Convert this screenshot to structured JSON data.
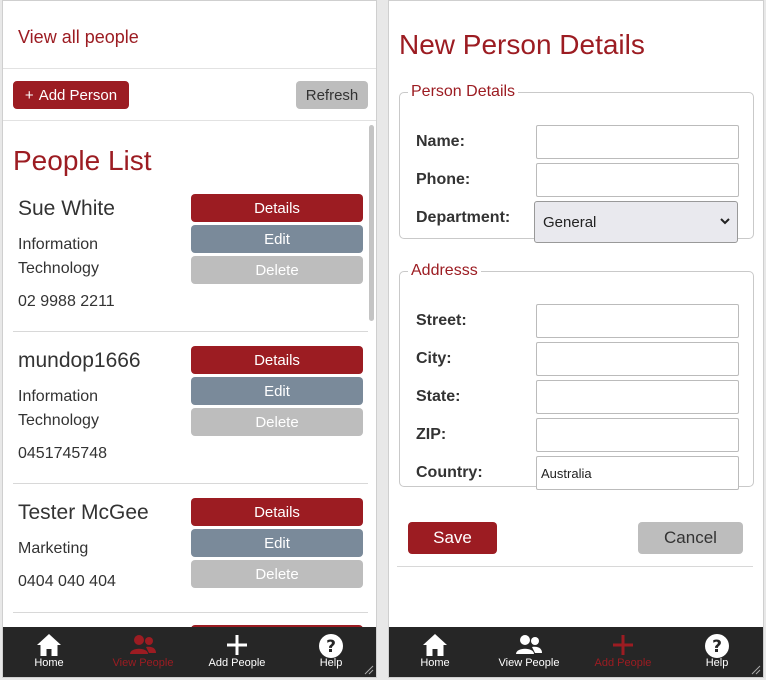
{
  "left": {
    "view_all_link": "View all people",
    "add_button": "Add Person",
    "add_button_icon": "+",
    "refresh_button": "Refresh",
    "list_title": "People List",
    "people": [
      {
        "name": "Sue White",
        "department": "Information Technology",
        "phone": "02 9988 2211"
      },
      {
        "name": "mundop1666",
        "department": "Information Technology",
        "phone": "0451745748"
      },
      {
        "name": "Tester McGee",
        "department": "Marketing",
        "phone": "0404 040 404"
      }
    ],
    "row_buttons": {
      "details": "Details",
      "edit": "Edit",
      "delete": "Delete"
    }
  },
  "right": {
    "title": "New Person Details",
    "person_fieldset": {
      "legend": "Person Details",
      "name_label": "Name:",
      "name_value": "",
      "phone_label": "Phone:",
      "phone_value": "",
      "department_label": "Department:",
      "department_selected": "General"
    },
    "address_fieldset": {
      "legend": "Addresss",
      "street_label": "Street:",
      "street_value": "",
      "city_label": "City:",
      "city_value": "",
      "state_label": "State:",
      "state_value": "",
      "zip_label": "ZIP:",
      "zip_value": "",
      "country_label": "Country:",
      "country_value": "Australia"
    },
    "save_button": "Save",
    "cancel_button": "Cancel"
  },
  "nav": {
    "home": "Home",
    "view_people": "View People",
    "add_people": "Add People",
    "help": "Help"
  },
  "colors": {
    "accent": "#9c1c22",
    "edit_button": "#7a8a9a",
    "neutral_button": "#bdbdbd",
    "nav_background": "#262626"
  },
  "icons": {
    "home": "home-icon",
    "view_people": "people-icon",
    "add_people": "plus-icon",
    "help": "help-icon"
  }
}
